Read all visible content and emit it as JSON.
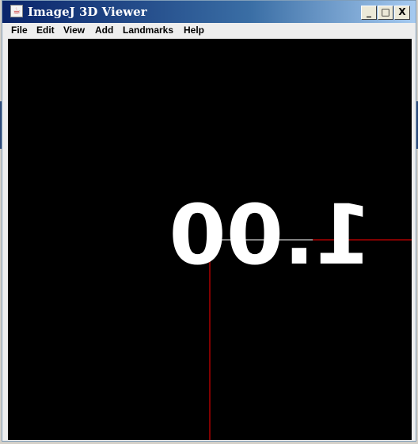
{
  "window": {
    "title": "ImageJ 3D Viewer",
    "buttons": {
      "minimize": "_",
      "maximize": "□",
      "close": "X"
    }
  },
  "menubar": [
    "File",
    "Edit",
    "View",
    "Add",
    "Landmarks",
    "Help"
  ],
  "viewer": {
    "label": "1.00",
    "axis_color": "#ff0000",
    "background": "#000000",
    "label_color": "#ffffff"
  }
}
